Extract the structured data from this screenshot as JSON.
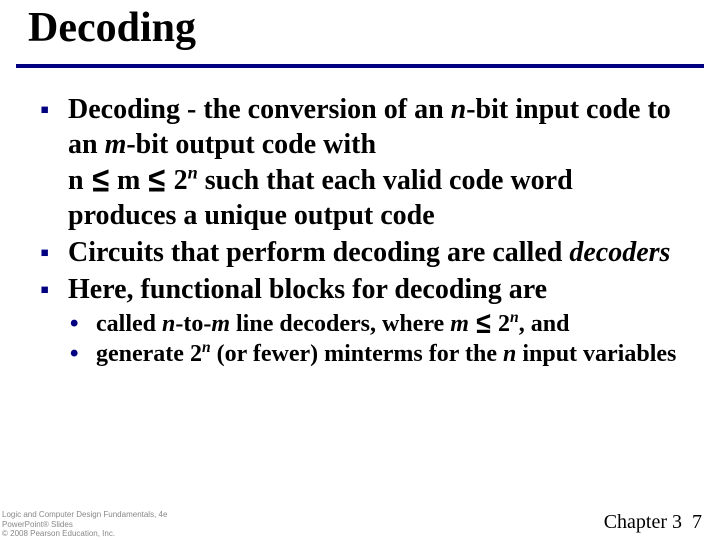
{
  "title": "Decoding",
  "bullets": [
    {
      "lead": "Decoding",
      "rest1": " - the conversion of an ",
      "nbit": "n",
      "rest2": "-bit input code to an ",
      "mbit": "m",
      "rest3": "-bit output code with",
      "line2a": "n ",
      "le1": "≤",
      "line2b": " m ",
      "le2": "≤",
      "line2c": "  2",
      "exp": "n",
      "line2d": " such that each valid code word produces a unique output code"
    },
    {
      "text1": "Circuits that perform decoding are called ",
      "decoders": "decoders"
    },
    {
      "text": "Here, functional blocks for decoding are"
    }
  ],
  "subbullets": [
    {
      "pre": " called ",
      "n": "n",
      "mid1": "-to-",
      "m": "m",
      "mid2": " line decoders, where ",
      "m2": "m",
      "sp": " ",
      "le": "≤",
      "sp2": "  2",
      "exp": "n",
      "post": ", and"
    },
    {
      "pre": "generate 2",
      "exp": "n",
      "mid": " (or fewer) minterms for the ",
      "n": "n",
      "post": "  input variables"
    }
  ],
  "footer": {
    "line1": "Logic and Computer Design Fundamentals, 4e",
    "line2": "PowerPoint® Slides",
    "line3": "© 2008 Pearson Education, Inc.",
    "chapter": "Chapter 3",
    "page": "7"
  }
}
